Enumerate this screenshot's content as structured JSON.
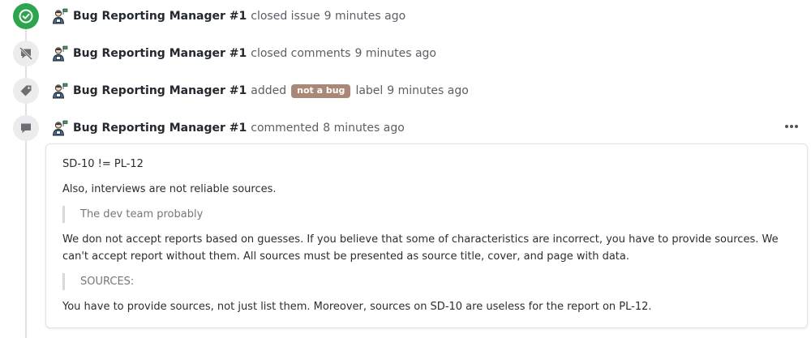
{
  "events": [
    {
      "icon": "check-circle-icon",
      "author": "Bug Reporting Manager #1",
      "action": "closed issue",
      "time": "9 minutes ago"
    },
    {
      "icon": "comment-slash-icon",
      "author": "Bug Reporting Manager #1",
      "action": "closed comments",
      "time": "9 minutes ago"
    },
    {
      "icon": "tag-icon",
      "author": "Bug Reporting Manager #1",
      "action": "added",
      "label": "not a bug",
      "suffix": "label",
      "time": "9 minutes ago"
    },
    {
      "icon": "comment-icon",
      "author": "Bug Reporting Manager #1",
      "action": "commented",
      "time": "8 minutes ago"
    }
  ],
  "comment": {
    "line1": "SD-10 != PL-12",
    "line2": "Also, interviews are not reliable sources.",
    "quote1": "The dev team probably",
    "paragraph": "We don not accept reports based on guesses. If you believe that some of characteristics are incorrect, you have to provide sources. We can't accept report without them. All sources must be presented as source title, cover, and page with data.",
    "quote2": "SOURCES:",
    "line3": "You have to provide sources, not just list them. Moreover, sources on SD-10 are useless for the report on PL-12."
  },
  "colors": {
    "closed_green": "#2da44e",
    "label_brown": "#a98878",
    "badge_grey": "#ececec"
  },
  "more_icon": "more-horizontal-icon",
  "avatar_icon": "avatar-manager-icon"
}
